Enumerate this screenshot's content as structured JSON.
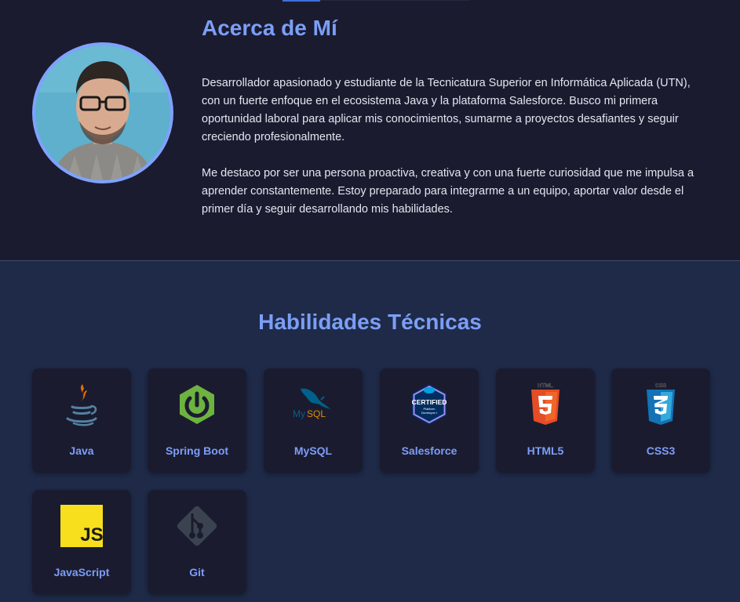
{
  "about": {
    "title": "Acerca de Mí",
    "paragraph1": "Desarrollador apasionado y estudiante de la Tecnicatura Superior en Informática Aplicada (UTN), con un fuerte enfoque en el ecosistema Java y la plataforma Salesforce. Busco mi primera oportunidad laboral para aplicar mis conocimientos, sumarme a proyectos desafiantes y seguir creciendo profesionalmente.",
    "paragraph2": "Me destaco por ser una persona proactiva, creativa y con una fuerte curiosidad que me impulsa a aprender constantemente. Estoy preparado para integrarme a un equipo, aportar valor desde el primer día y seguir desarrollando mis habilidades."
  },
  "skills": {
    "title": "Habilidades Técnicas",
    "items": [
      {
        "label": "Java",
        "icon": "java-icon"
      },
      {
        "label": "Spring Boot",
        "icon": "spring-boot-icon"
      },
      {
        "label": "MySQL",
        "icon": "mysql-icon"
      },
      {
        "label": "Salesforce",
        "icon": "salesforce-certified-icon",
        "badge_text": "CERTIFIED",
        "badge_sub": "Platform Developer I"
      },
      {
        "label": "HTML5",
        "icon": "html5-icon",
        "badge_text": "HTML"
      },
      {
        "label": "CSS3",
        "icon": "css3-icon",
        "badge_text": "CSS"
      },
      {
        "label": "JavaScript",
        "icon": "javascript-icon",
        "badge_text": "JS"
      },
      {
        "label": "Git",
        "icon": "git-icon"
      }
    ]
  },
  "colors": {
    "accent": "#7c9ef6",
    "background": "#1b1b30",
    "skills_background": "#1e2a48",
    "card": "#1b1b30"
  }
}
